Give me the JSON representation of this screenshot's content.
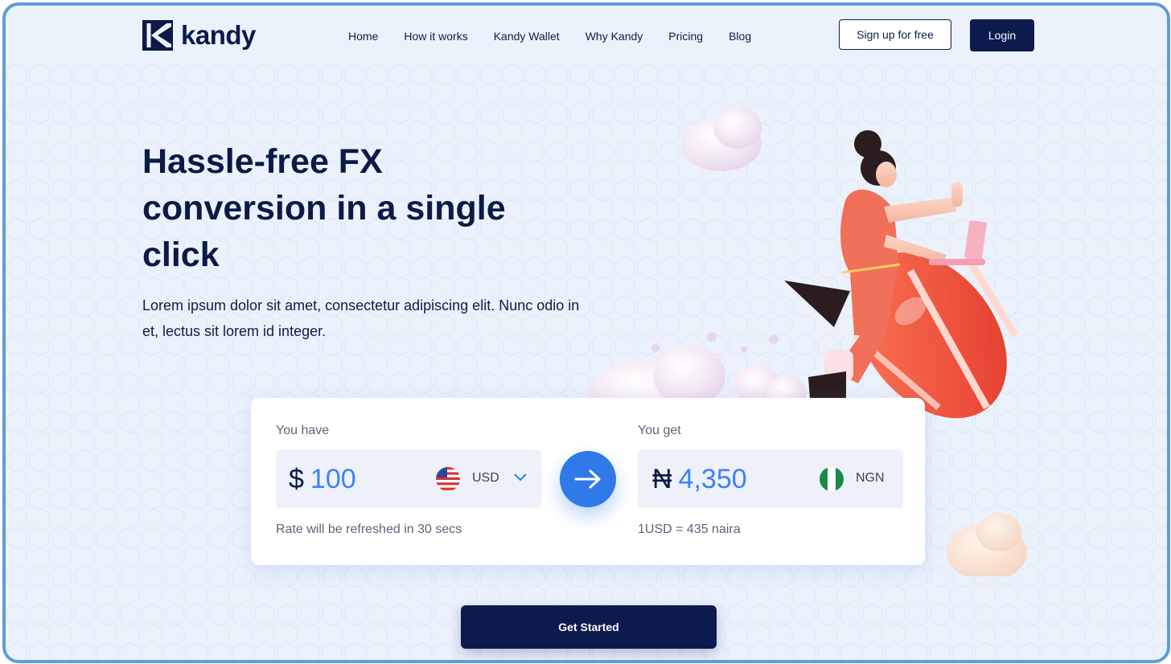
{
  "brand": {
    "name": "kandy",
    "logo_icon": "kandy-k-icon"
  },
  "nav": {
    "items": [
      "Home",
      "How it works",
      "Kandy Wallet",
      "Why Kandy",
      "Pricing",
      "Blog"
    ],
    "signup_label": "Sign up for free",
    "login_label": "Login"
  },
  "hero": {
    "headline": "Hassle-free FX conversion in a single click",
    "subtext": "Lorem ipsum dolor sit amet, consectetur adipiscing elit. Nunc odio in et, lectus sit lorem id integer."
  },
  "converter": {
    "have_label": "You have",
    "have_symbol": "$",
    "have_amount": "100",
    "have_currency": "USD",
    "have_flag": "us-flag-icon",
    "get_label": "You get",
    "get_symbol": "₦",
    "get_amount": "4,350",
    "get_currency": "NGN",
    "get_flag": "nigeria-flag-icon",
    "swap_icon": "arrow-right-icon",
    "refresh_note": "Rate will be refreshed in 30 secs",
    "rate_note": "1USD = 435 naira"
  },
  "cta": {
    "label": "Get Started"
  },
  "colors": {
    "navy": "#0c1a4d",
    "accent": "#2f7ae8",
    "background": "#ecf2fc",
    "rocket": "#ff5a3c"
  }
}
